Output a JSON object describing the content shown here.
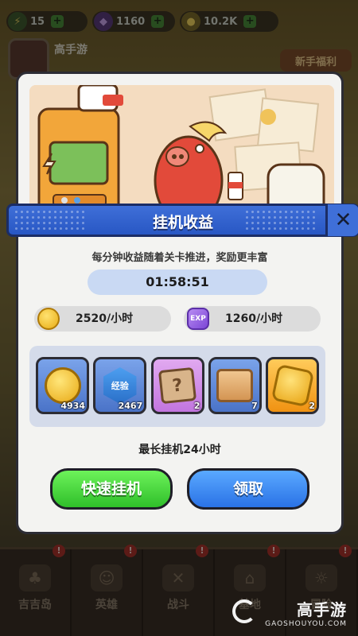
{
  "colors": {
    "title_bar": "#2857c4",
    "quick_button": "#2fbf2a",
    "claim_button": "#2a72e6",
    "timer_bg": "#c9d9f3",
    "panel_bg": "#f3f3f1"
  },
  "topbar": {
    "stamina": {
      "icon": "lightning-icon",
      "value": "15"
    },
    "gems": {
      "icon": "purple-gem-icon",
      "value": "1160"
    },
    "gold": {
      "icon": "gold-coin-icon",
      "value": "10.2K"
    }
  },
  "background": {
    "player_name": "高手游",
    "badge": "新手福利"
  },
  "modal": {
    "title": "挂机收益",
    "subtitle": "每分钟收益随着关卡推进，奖励更丰富",
    "timer": "01:58:51",
    "rates": [
      {
        "icon": "gold-coin-icon",
        "value": "2520/小时"
      },
      {
        "icon": "exp-icon",
        "icon_text": "EXP",
        "value": "1260/小时"
      }
    ],
    "rewards": [
      {
        "icon": "gold-coin-icon",
        "count": "4934",
        "style": "blue"
      },
      {
        "icon": "exp-hexagon-icon",
        "label": "经验",
        "count": "2467",
        "style": "blue"
      },
      {
        "icon": "mystery-box-icon",
        "label": "?",
        "count": "2",
        "style": "purple"
      },
      {
        "icon": "supply-crate-icon",
        "count": "7",
        "style": "blue"
      },
      {
        "icon": "gold-token-icon",
        "count": "2",
        "style": "orange"
      }
    ],
    "max_idle": "最长挂机24小时",
    "buttons": {
      "quick": "快速挂机",
      "claim": "领取"
    }
  },
  "bottom_nav": [
    {
      "label": "吉吉岛",
      "icon": "island-icon",
      "alert": "!"
    },
    {
      "label": "英雄",
      "icon": "hero-icon",
      "alert": "!"
    },
    {
      "label": "战斗",
      "icon": "crossed-swords-icon",
      "alert": "!"
    },
    {
      "label": "基地",
      "icon": "base-icon",
      "alert": "!"
    },
    {
      "label": "冒险",
      "icon": "adventure-icon",
      "alert": "!"
    }
  ],
  "watermark": {
    "brand": "高手游",
    "url": "GAOSHOUYOU.COM"
  }
}
